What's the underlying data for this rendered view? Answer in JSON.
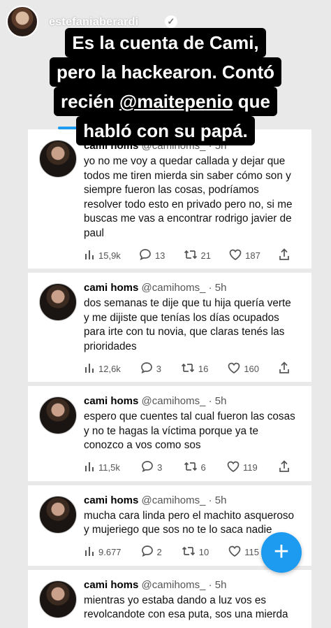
{
  "story": {
    "username": "estefaniaberardi",
    "caption": [
      {
        "pre": "Es la cuenta de Cami,",
        "mention": "",
        "post": ""
      },
      {
        "pre": "pero la hackearon. Contó",
        "mention": "",
        "post": ""
      },
      {
        "pre": "recién ",
        "mention": "@maitepenio",
        "post": " que"
      },
      {
        "pre": "habló con su papá.",
        "mention": "",
        "post": ""
      }
    ]
  },
  "tweets": [
    {
      "name": "cami homs",
      "handle": "@camihoms_ · 5h",
      "text": "yo no me voy a quedar callada y dejar que\ntodos me tiren mierda sin saber cómo son y\nsiempre fueron las cosas, podríamos\nresolver todo esto en privado pero no, si me\nbuscas me vas a encontrar rodrigo javier de\npaul",
      "views": "15,9k",
      "replies": "13",
      "retweets": "21",
      "likes": "187"
    },
    {
      "name": "cami homs",
      "handle": "@camihoms_ · 5h",
      "text": "dos semanas te dije que tu hija quería verte\ny me dijiste que tenías los días ocupados\npara irte con tu novia, que claras tenés las\nprioridades",
      "views": "12,6k",
      "replies": "3",
      "retweets": "16",
      "likes": "160"
    },
    {
      "name": "cami homs",
      "handle": "@camihoms_ · 5h",
      "text": "espero que cuentes tal cual fueron las cosas\ny no te hagas la víctima porque ya te\nconozco a vos como sos",
      "views": "11,5k",
      "replies": "3",
      "retweets": "6",
      "likes": "119"
    },
    {
      "name": "cami homs",
      "handle": "@camihoms_ · 5h",
      "text": "mucha cara linda pero el machito asqueroso\ny mujeriego que sos no te lo saca nadie",
      "views": "9.677",
      "replies": "2",
      "retweets": "10",
      "likes": "115"
    },
    {
      "name": "cami homs",
      "handle": "@camihoms_ · 5h",
      "text": "mientras yo estaba dando a luz vos es\nrevolcandote con esa puta, sos una mierda",
      "views": "",
      "replies": "",
      "retweets": "",
      "likes": ""
    }
  ],
  "fab": {
    "label": "+",
    "icon": "compose-plus-icon"
  },
  "colors": {
    "accent": "#1d9bf0",
    "caption_bg": "#000000"
  }
}
